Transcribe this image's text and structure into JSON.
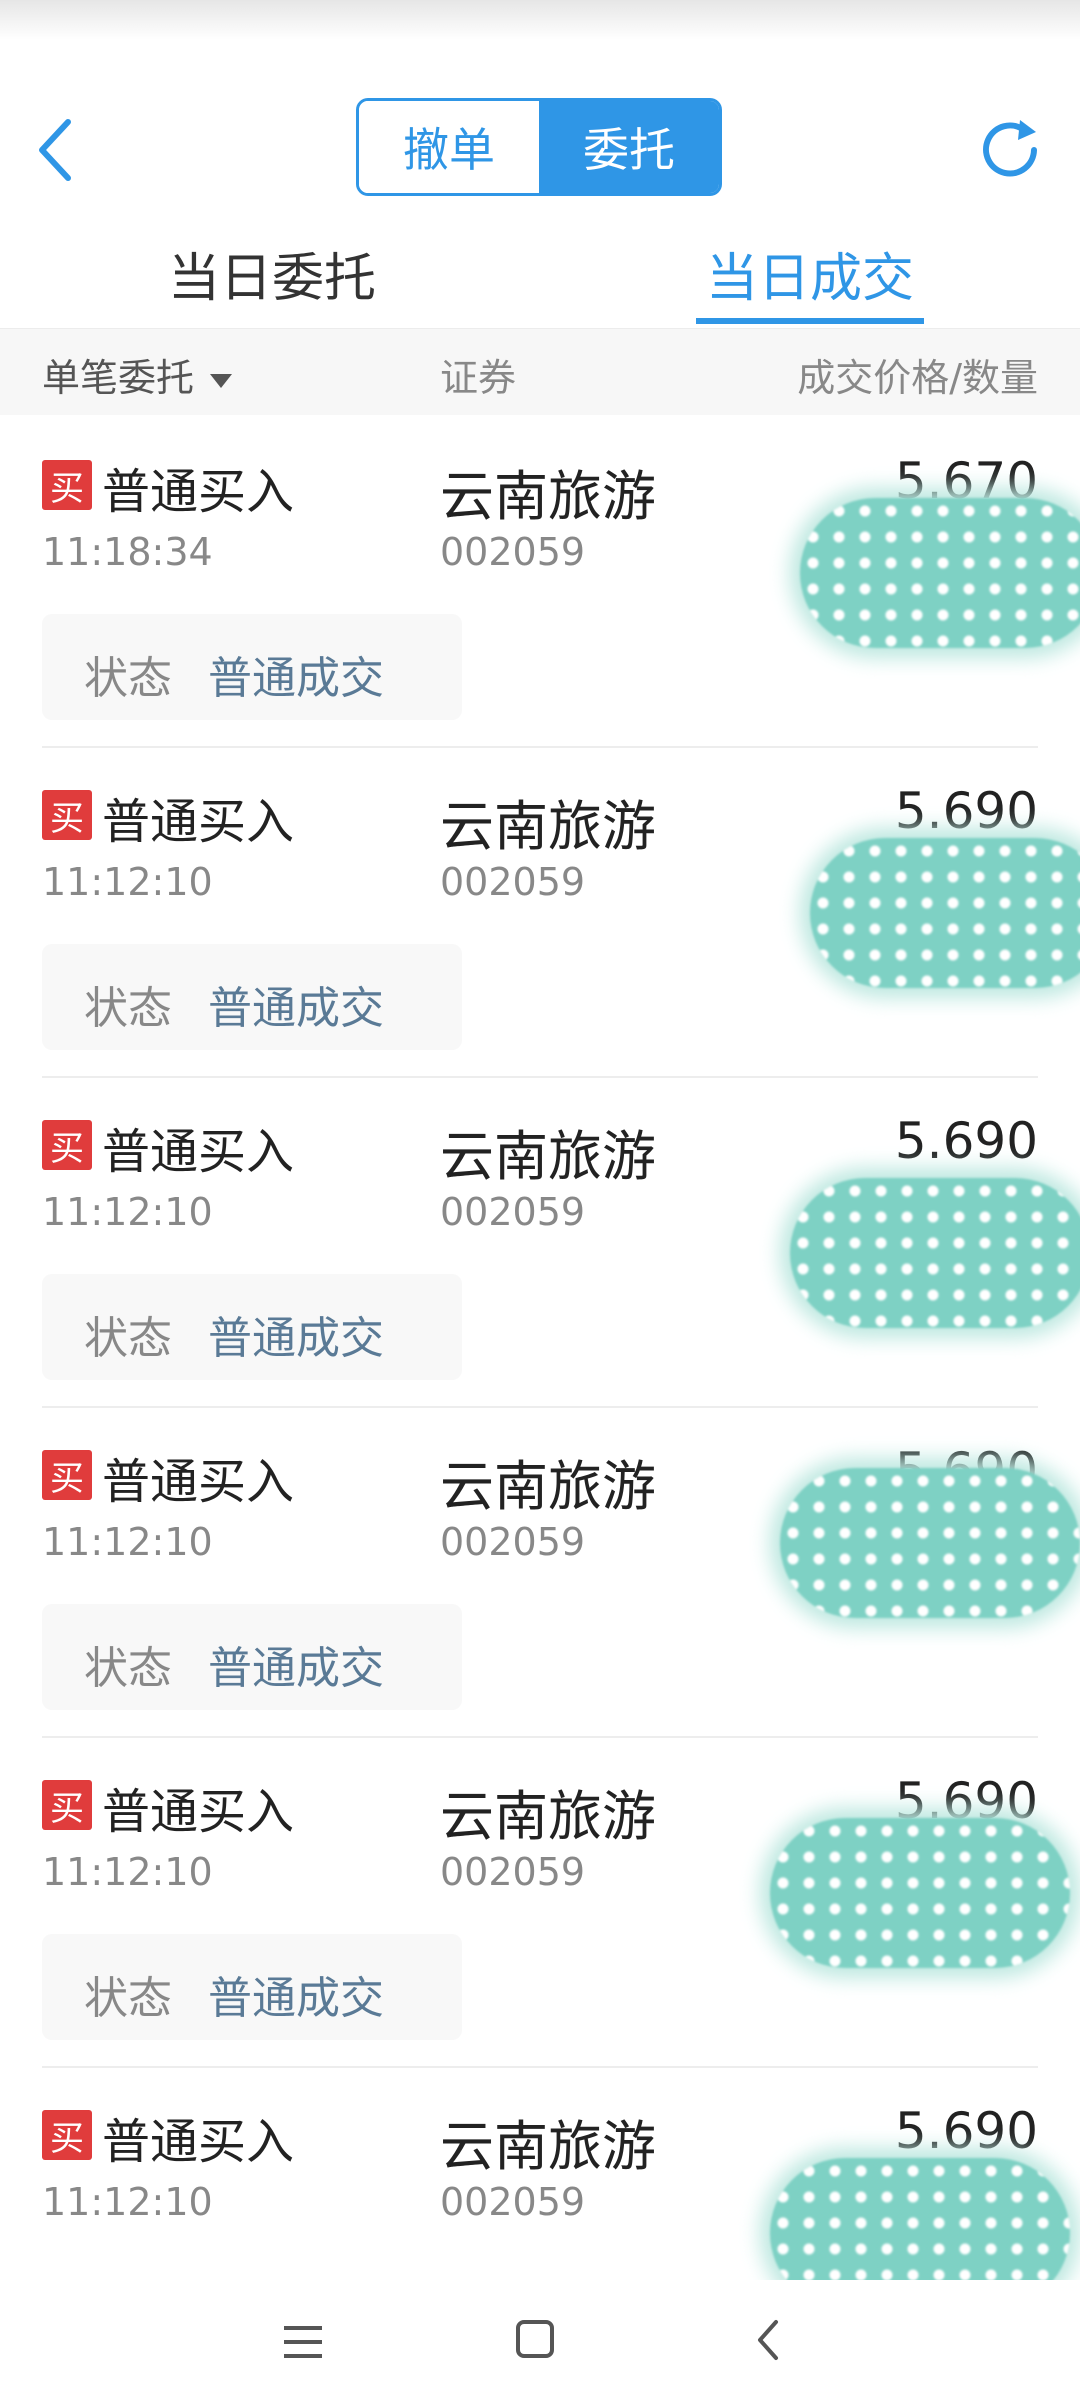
{
  "header": {
    "segment": {
      "cancel_label": "撤单",
      "entrust_label": "委托"
    }
  },
  "tabs": {
    "today_orders": "当日委托",
    "today_trades": "当日成交"
  },
  "columns": {
    "single_order": "单笔委托",
    "security": "证券",
    "price_qty": "成交价格/数量"
  },
  "trades": [
    {
      "badge": "买",
      "type": "普通买入",
      "time": "11:18:34",
      "name": "云南旅游",
      "code": "002059",
      "price": "5.670",
      "status_label": "状态",
      "status": "普通成交"
    },
    {
      "badge": "买",
      "type": "普通买入",
      "time": "11:12:10",
      "name": "云南旅游",
      "code": "002059",
      "price": "5.690",
      "status_label": "状态",
      "status": "普通成交"
    },
    {
      "badge": "买",
      "type": "普通买入",
      "time": "11:12:10",
      "name": "云南旅游",
      "code": "002059",
      "price": "5.690",
      "status_label": "状态",
      "status": "普通成交"
    },
    {
      "badge": "买",
      "type": "普通买入",
      "time": "11:12:10",
      "name": "云南旅游",
      "code": "002059",
      "price": "5.690",
      "status_label": "状态",
      "status": "普通成交"
    },
    {
      "badge": "买",
      "type": "普通买入",
      "time": "11:12:10",
      "name": "云南旅游",
      "code": "002059",
      "price": "5.690",
      "status_label": "状态",
      "status": "普通成交"
    },
    {
      "badge": "买",
      "type": "普通买入",
      "time": "11:12:10",
      "name": "云南旅游",
      "code": "002059",
      "price": "5.690"
    }
  ],
  "colors": {
    "accent": "#2f96e6",
    "buy_badge": "#e03c3c",
    "redaction": "#7ed1c4"
  },
  "icons": [
    "back-arrow-icon",
    "refresh-icon",
    "caret-down-icon",
    "menu-icon",
    "home-icon",
    "back-icon"
  ]
}
